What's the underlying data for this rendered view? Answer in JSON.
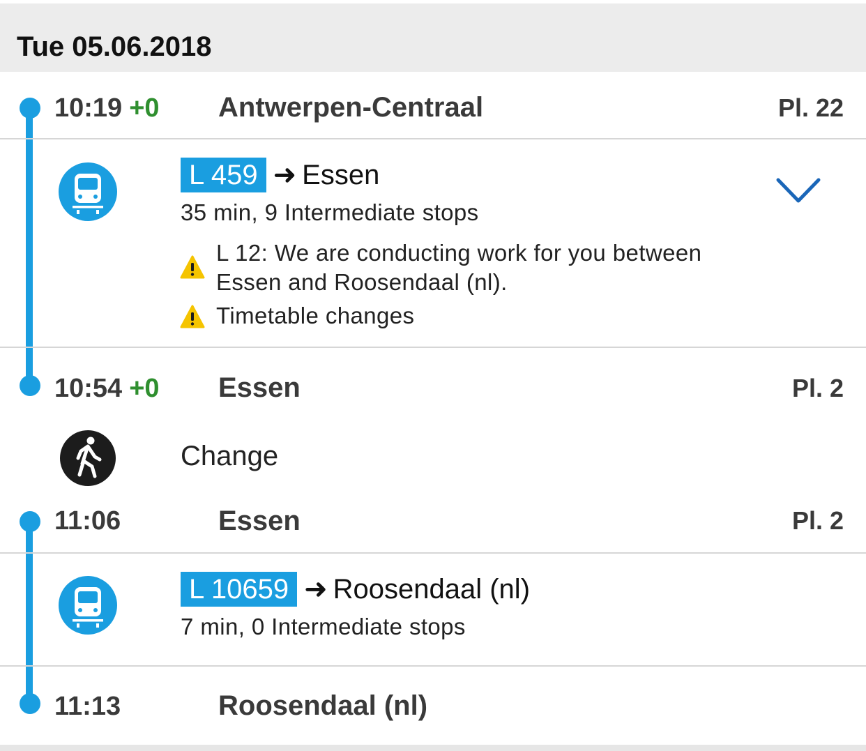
{
  "header": {
    "date": "Tue 05.06.2018"
  },
  "legs": [
    {
      "departure": {
        "time": "10:19",
        "delay": "+0",
        "station": "Antwerpen-Centraal",
        "platform": "Pl. 22"
      },
      "service": {
        "line": "L 459",
        "destination": "Essen",
        "details": "35 min, 9 Intermediate stops"
      },
      "notices": [
        {
          "line1": "L 12: We are conducting work for you between",
          "line2": "Essen and Roosendaal (nl)."
        },
        {
          "line1": "Timetable changes"
        }
      ],
      "arrival": {
        "time": "10:54",
        "delay": "+0",
        "station": "Essen",
        "platform": "Pl. 2"
      }
    },
    {
      "departure": {
        "time": "11:06",
        "station": "Essen",
        "platform": "Pl. 2"
      },
      "service": {
        "line": "L 10659",
        "destination": "Roosendaal (nl)",
        "details": "7 min, 0 Intermediate stops"
      },
      "arrival": {
        "time": "11:13",
        "station": "Roosendaal (nl)"
      }
    }
  ],
  "transfer": {
    "label": "Change"
  },
  "icons": {
    "train": "train-icon",
    "walk": "walk-icon",
    "warning": "warning-icon",
    "expand": "chevron-down-icon"
  },
  "colors": {
    "accent": "#1a9ee0",
    "delay_ok": "#2f8f2f",
    "warning": "#f5c400",
    "chevron": "#1a66b8"
  },
  "arrow_glyph": "➜"
}
